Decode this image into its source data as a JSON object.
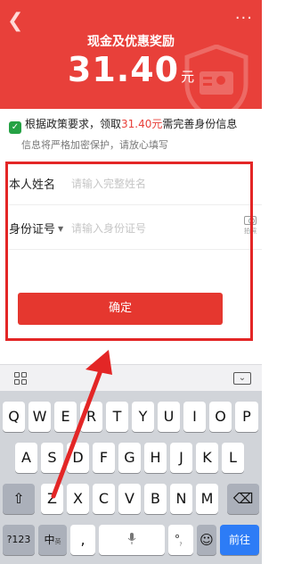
{
  "header": {
    "back_icon": "chevron-left-icon",
    "more_label": "···",
    "title": "现金及优惠奖励",
    "amount": "31.40",
    "unit": "元",
    "bg_color": "#e8403a"
  },
  "notice": {
    "line1_prefix": "根据政策要求，领取",
    "line1_amount": "31.40元",
    "line1_suffix": "需完善身份信息",
    "line2": "信息将严格加密保护，请放心填写",
    "check_icon": "✓"
  },
  "form": {
    "name_label": "本人姓名",
    "name_placeholder": "请输入完整姓名",
    "id_label": "身份证号",
    "id_caret": "▼",
    "id_placeholder": "请输入身份证号",
    "camera_label": "拍照",
    "confirm_label": "确定",
    "accent": "#e5372f"
  },
  "keyboard": {
    "hide_icon": "⌄",
    "row1": [
      "Q",
      "W",
      "E",
      "R",
      "T",
      "Y",
      "U",
      "I",
      "O",
      "P"
    ],
    "row2": [
      "A",
      "S",
      "D",
      "F",
      "G",
      "H",
      "J",
      "K",
      "L"
    ],
    "row3": [
      "Z",
      "X",
      "C",
      "V",
      "B",
      "N",
      "M"
    ],
    "shift": "⇧",
    "delete": "⌫",
    "num_key": "?123",
    "lang_key": "中",
    "lang_sub": "英",
    "comma_key": ",",
    "space_icon": "🎤",
    "period_key": "。",
    "period_sub": "?",
    "emoji_icon": "☺",
    "go_key": "前往"
  }
}
